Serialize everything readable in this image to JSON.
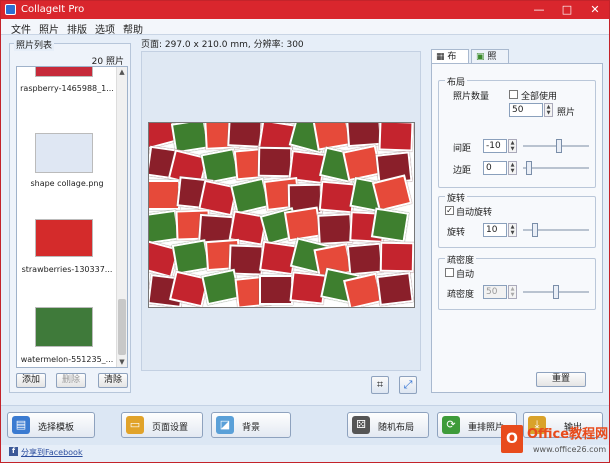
{
  "window": {
    "title": "CollageIt Pro",
    "minimize": "—",
    "maximize": "□",
    "close": "✕"
  },
  "menu": [
    "文件",
    "照片",
    "排版",
    "选项",
    "帮助"
  ],
  "photos": {
    "group_title": "照片列表",
    "count": "20 照片",
    "items": [
      {
        "label": "raspberry-1465988_1...",
        "color": "#c62a3a"
      },
      {
        "label": "shape collage.png",
        "color": "#dfe7f3"
      },
      {
        "label": "strawberries-130337...",
        "color": "#d42b2b"
      },
      {
        "label": "watermelon-551235_...",
        "color": "#3f7a3a"
      }
    ],
    "add": "添加",
    "delete": "删除",
    "clear": "清除"
  },
  "page_info": "页面: 297.0 x 210.0 mm, 分辨率: 300",
  "tabs": {
    "layout": "布局",
    "photo": "照片"
  },
  "layout_group": {
    "title": "布局",
    "photo_count_label": "照片数量",
    "use_all": "全部使用",
    "count_value": "50",
    "count_unit": "照片",
    "spacing_label": "间距",
    "spacing_value": "-10",
    "margin_label": "边距",
    "margin_value": "0",
    "spacing_slider": 0.55,
    "margin_slider": 0.05
  },
  "rotation_group": {
    "title": "旋转",
    "auto_rotate": "自动旋转",
    "rotate_label": "旋转",
    "rotate_value": "10",
    "rotate_slider": 0.15
  },
  "density_group": {
    "title": "疏密度",
    "auto": "自动",
    "density_label": "疏密度",
    "density_value": "50",
    "density_slider": 0.5
  },
  "reset": "重置",
  "bottom": {
    "template": "选择模板",
    "page_setup": "页面设置",
    "background": "背景",
    "random_layout": "随机布局",
    "reshuffle": "重排照片",
    "output": "输出"
  },
  "facebook": "分享到Facebook",
  "watermark": {
    "brand": "Office教程网",
    "url": "www.office26.com"
  },
  "collage_colors": [
    "#c4242e",
    "#8fb64a",
    "#f1d24a",
    "#5a2a2a",
    "#d8e4f2",
    "#a53b2a",
    "#3e7f2f",
    "#e9b8c4",
    "#f4a12a",
    "#7b4e8f",
    "#2f2f2f",
    "#c9d7a3",
    "#e64a3a",
    "#6da84a",
    "#f2e8c8",
    "#b8262f",
    "#4d8f3a",
    "#f0c040",
    "#8a1f2a",
    "#dbe3ea",
    "#a4c85a",
    "#d94f6a",
    "#2a4a8a",
    "#e8e060"
  ]
}
